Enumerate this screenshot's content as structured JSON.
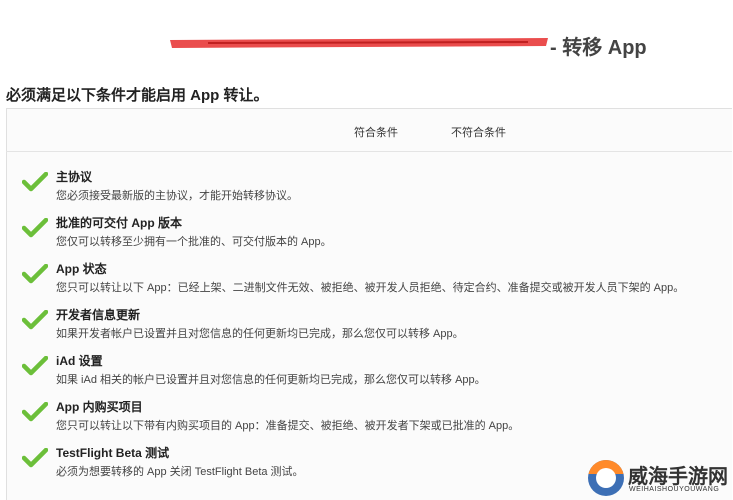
{
  "header": {
    "title_suffix": "- 转移 App",
    "redaction_color": "#e83a3a"
  },
  "subtitle": "必须满足以下条件才能启用 App 转让。",
  "columns": {
    "met": "符合条件",
    "not_met": "不符合条件"
  },
  "check_color": "#6cbf3a",
  "conditions": [
    {
      "title": "主协议",
      "desc": "您必须接受最新版的主协议，才能开始转移协议。",
      "met": true
    },
    {
      "title": "批准的可交付 App 版本",
      "desc": "您仅可以转移至少拥有一个批准的、可交付版本的 App。",
      "met": true
    },
    {
      "title": "App 状态",
      "desc": "您只可以转让以下 App：已经上架、二进制文件无效、被拒绝、被开发人员拒绝、待定合约、准备提交或被开发人员下架的 App。",
      "met": true
    },
    {
      "title": "开发者信息更新",
      "desc": "如果开发者帐户已设置并且对您信息的任何更新均已完成，那么您仅可以转移 App。",
      "met": true
    },
    {
      "title": "iAd 设置",
      "desc": "如果 iAd 相关的帐户已设置并且对您信息的任何更新均已完成，那么您仅可以转移 App。",
      "met": true
    },
    {
      "title": "App 内购买项目",
      "desc": "您只可以转让以下带有内购买项目的 App：准备提交、被拒绝、被开发者下架或已批准的 App。",
      "met": true
    },
    {
      "title": "TestFlight Beta 测试",
      "desc": "必须为想要转移的 App 关闭 TestFlight Beta 测试。",
      "met": true
    }
  ],
  "watermark": {
    "name": "威海手游网",
    "url": "WEIHAISHOUYOUWANG",
    "logo_colors": [
      "#3d6fb5",
      "#ff8a2a"
    ]
  }
}
